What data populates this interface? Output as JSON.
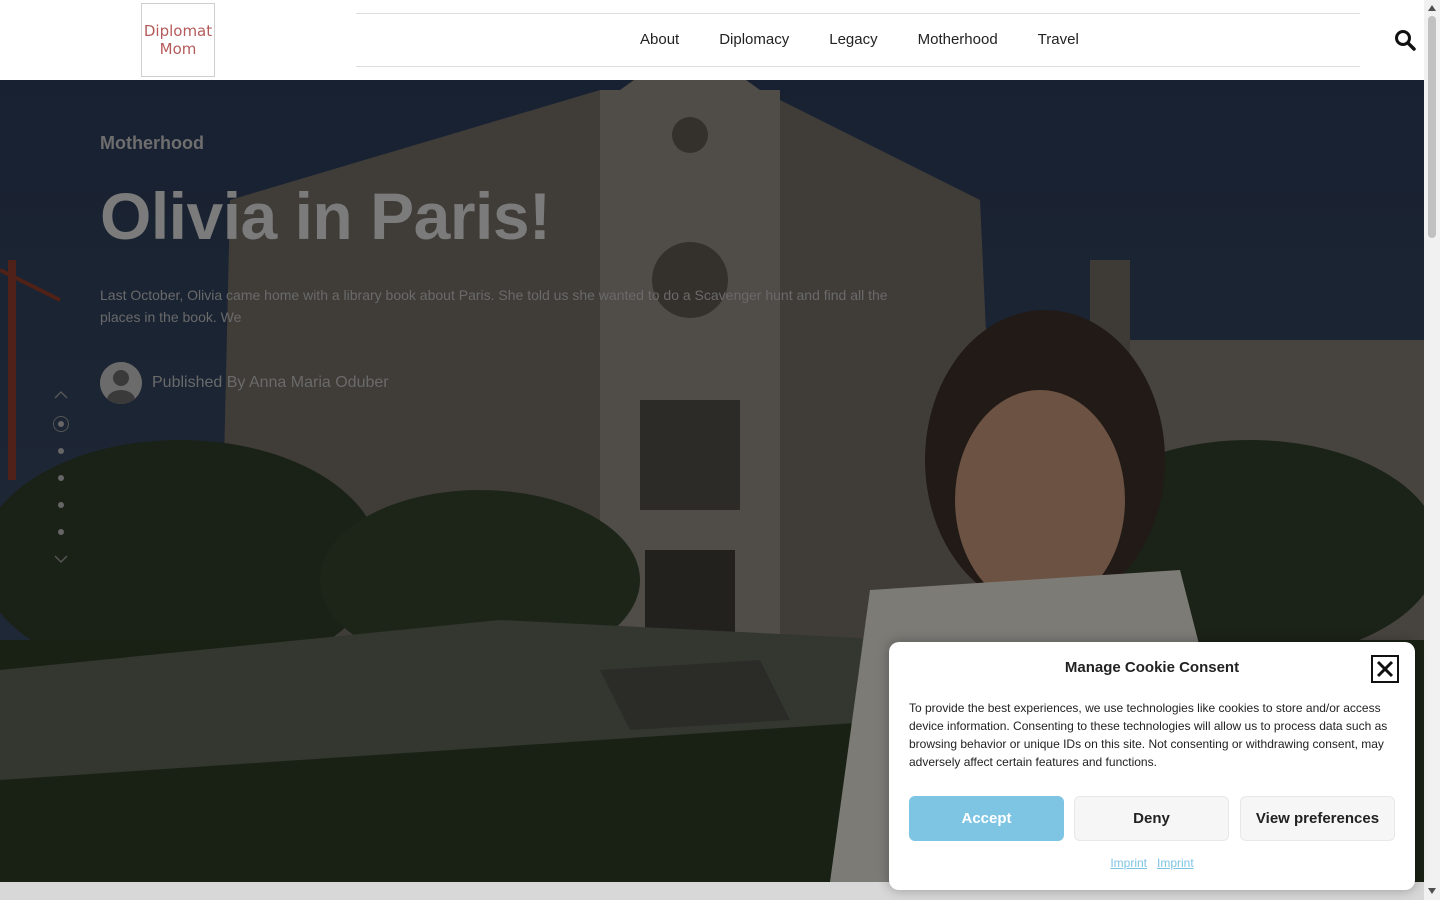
{
  "header": {
    "logo": {
      "line1": "Diplomat",
      "line2": "Mom"
    },
    "nav": [
      {
        "label": "About"
      },
      {
        "label": "Diplomacy"
      },
      {
        "label": "Legacy"
      },
      {
        "label": "Motherhood"
      },
      {
        "label": "Travel"
      }
    ],
    "search_icon": "search-icon"
  },
  "hero": {
    "category": "Motherhood",
    "title": "Olivia in Paris!",
    "excerpt": "Last October, Olivia came home with a library book about Paris. She told us she wanted to do a Scavenger hunt and find all the places in the book. We",
    "author": "Published By Anna Maria Oduber",
    "slider": {
      "total_slides": 5,
      "active_slide": 1
    }
  },
  "cookie": {
    "title": "Manage Cookie Consent",
    "body": "To provide the best experiences, we use technologies like cookies to store and/or access device information. Consenting to these technologies will allow us to process data such as browsing behavior or unique IDs on this site. Not consenting or withdrawing consent, may adversely affect certain features and functions.",
    "accept": "Accept",
    "deny": "Deny",
    "preferences": "View preferences",
    "links": [
      "Imprint",
      "Imprint"
    ],
    "accent_color": "#7ec4e3"
  }
}
